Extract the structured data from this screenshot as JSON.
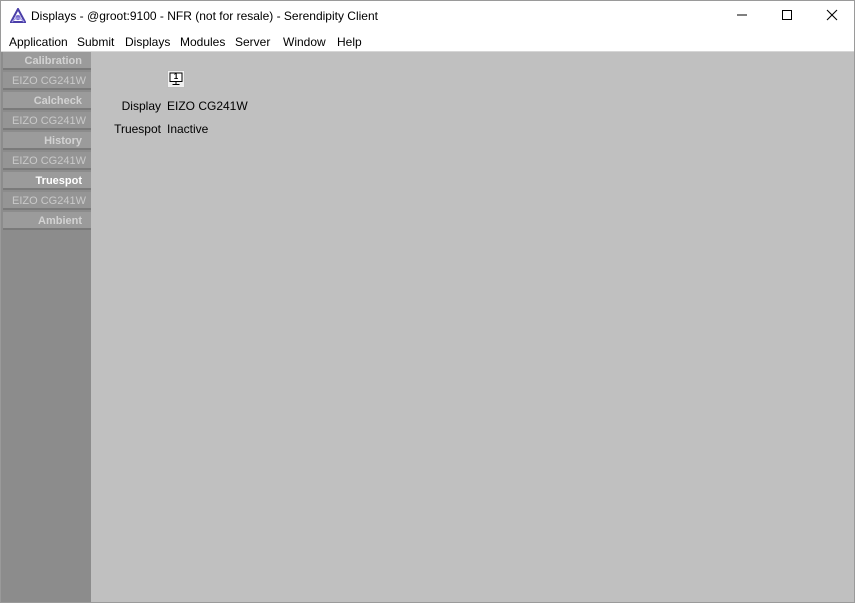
{
  "window": {
    "title": "Displays - @groot:9100 - NFR (not for resale) - Serendipity Client",
    "app_icon": "serendipity-logo-icon",
    "controls": [
      "minimize-icon",
      "maximize-icon",
      "close-icon"
    ]
  },
  "menubar": {
    "items": [
      {
        "label": "Application"
      },
      {
        "label": "Submit"
      },
      {
        "label": "Displays"
      },
      {
        "label": "Modules"
      },
      {
        "label": "Server"
      },
      {
        "label": "Window"
      },
      {
        "label": "Help"
      }
    ]
  },
  "sidebar": {
    "items": [
      {
        "label": "Calibration",
        "type": "heading",
        "active": false
      },
      {
        "label": "EIZO CG241W",
        "type": "sub"
      },
      {
        "label": "Calcheck",
        "type": "heading",
        "active": false
      },
      {
        "label": "EIZO CG241W",
        "type": "sub"
      },
      {
        "label": "History",
        "type": "heading",
        "active": false
      },
      {
        "label": "EIZO CG241W",
        "type": "sub"
      },
      {
        "label": "Truespot",
        "type": "heading",
        "active": true
      },
      {
        "label": "EIZO CG241W",
        "type": "sub"
      },
      {
        "label": "Ambient",
        "type": "heading",
        "active": false
      }
    ]
  },
  "main": {
    "monitor_number": "1",
    "fields": [
      {
        "label": "Display",
        "value": "EIZO CG241W"
      },
      {
        "label": "Truespot",
        "value": "Inactive"
      }
    ]
  },
  "colors": {
    "content_bg": "#c0c0c0",
    "sidebar_bg": "#8c8c8c",
    "sidebar_active_text": "#ffffff",
    "sidebar_inactive_text": "#d2d2d2"
  }
}
